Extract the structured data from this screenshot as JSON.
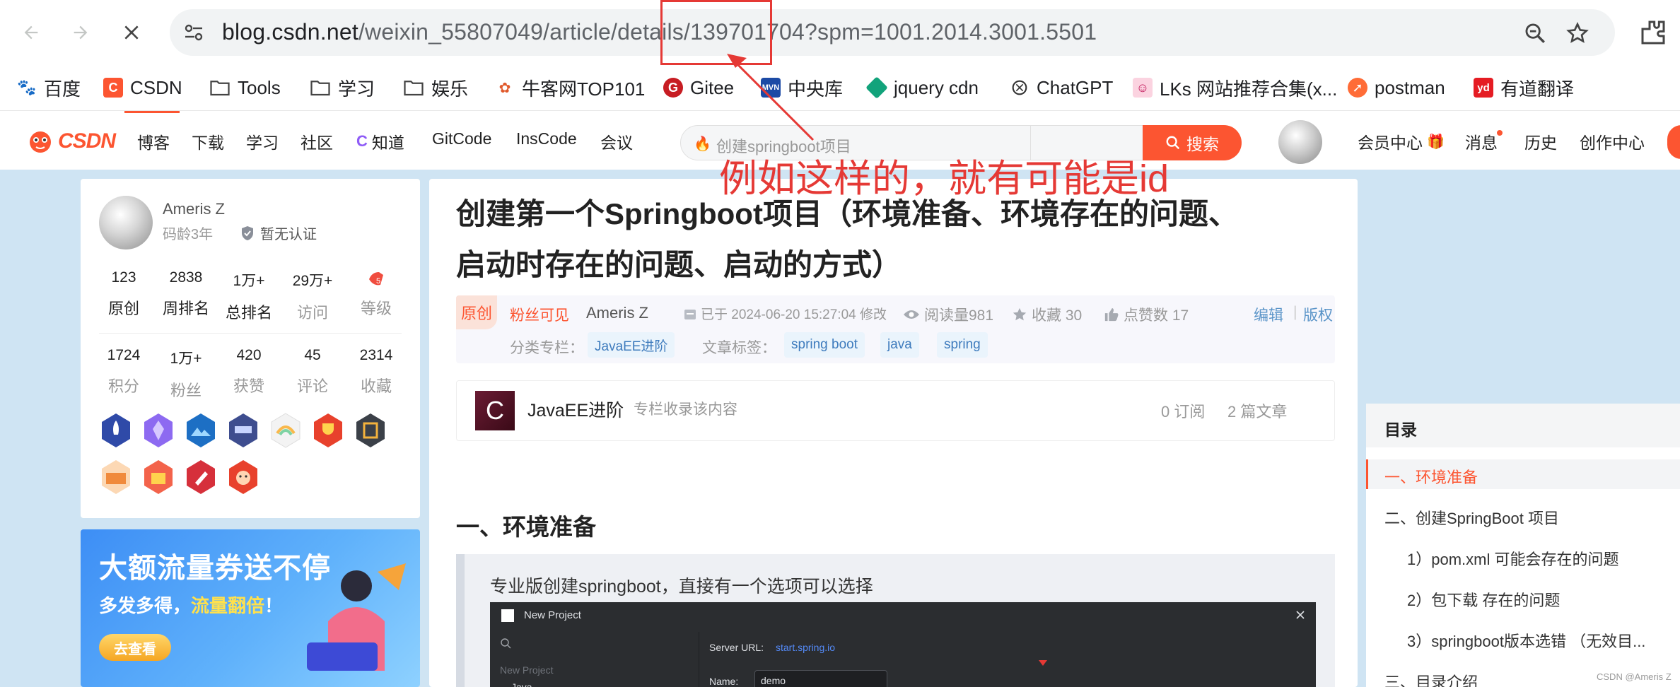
{
  "browser": {
    "url_host": "blog.csdn.net",
    "url_path": "/weixin_55807049/article/details/139701704?spm=1001.2014.3001.5501",
    "bookmarks": [
      "百度",
      "CSDN",
      "Tools",
      "学习",
      "娱乐",
      "牛客网TOP101",
      "Gitee",
      "中央库",
      "jquery cdn",
      "ChatGPT",
      "LKs 网站推荐合集(x...",
      "postman",
      "有道翻译"
    ]
  },
  "toolbar": {
    "logo": "CSDN",
    "nav": [
      "博客",
      "下载",
      "学习",
      "社区",
      "知道",
      "GitCode",
      "InsCode",
      "会议"
    ],
    "search_placeholder": "创建springboot项目",
    "search_button": "搜索",
    "right_links": [
      "会员中心",
      "消息",
      "历史",
      "创作中心"
    ]
  },
  "profile": {
    "name": "Ameris Z",
    "age": "码龄3年",
    "cert": "暂无认证",
    "stats_row1": [
      {
        "num": "123",
        "label": "原创"
      },
      {
        "num": "2838",
        "label": "周排名"
      },
      {
        "num": "1万+",
        "label": "总排名"
      },
      {
        "num": "29万+",
        "label": "访问"
      },
      {
        "num": "",
        "label": "等级"
      }
    ],
    "stats_row2": [
      {
        "num": "1724",
        "label": "积分"
      },
      {
        "num": "1万+",
        "label": "粉丝"
      },
      {
        "num": "420",
        "label": "获赞"
      },
      {
        "num": "45",
        "label": "评论"
      },
      {
        "num": "2314",
        "label": "收藏"
      }
    ]
  },
  "ad": {
    "title": "大额流量券送不停",
    "sub_prefix": "多发多得，",
    "sub_highlight": "流量翻倍",
    "sub_suffix": "！",
    "button": "去查看"
  },
  "article": {
    "title_line1": "创建第一个Springboot项目（环境准备、环境存在的问题、",
    "title_line2": "启动时存在的问题、启动的方式）",
    "orig_tag": "原创",
    "fans_visible": "粉丝可见",
    "author": "Ameris Z",
    "modified": "已于 2024-06-20 15:27:04 修改",
    "reads": "阅读量981",
    "favorites": "收藏 30",
    "likes": "点赞数 17",
    "edit": "编辑",
    "copyright": "版权",
    "column_label": "分类专栏：",
    "column_chip": "JavaEE进阶",
    "tags_label": "文章标签：",
    "tags": [
      "spring boot",
      "java",
      "spring"
    ],
    "column_box": {
      "icon_letter": "C",
      "name": "JavaEE进阶",
      "desc": "专栏收录该内容",
      "subs": "0 订阅",
      "count": "2 篇文章"
    },
    "h2": "一、环境准备",
    "quote_text": "专业版创建springboot，直接有一个选项可以选择",
    "ide": {
      "title": "New Project",
      "left_item": "New Project",
      "left_item2": "Java",
      "server_url_label": "Server URL:",
      "server_url": "start.spring.io",
      "name_label": "Name:",
      "name_value": "demo"
    }
  },
  "toc": {
    "title": "目录",
    "items": [
      "一、环境准备",
      "二、创建SpringBoot 项目",
      "1）pom.xml 可能会存在的问题",
      "2）包下载 存在的问题",
      "3）springboot版本选错 （无效目...",
      "三、目录介绍"
    ]
  },
  "annotation": {
    "text": "例如这样的，就有可能是id"
  },
  "watermark": "CSDN @Ameris Z",
  "colors": {
    "csdn_red": "#fc5531",
    "annotation_red": "#e53935",
    "page_bg": "#cfe4f3"
  }
}
